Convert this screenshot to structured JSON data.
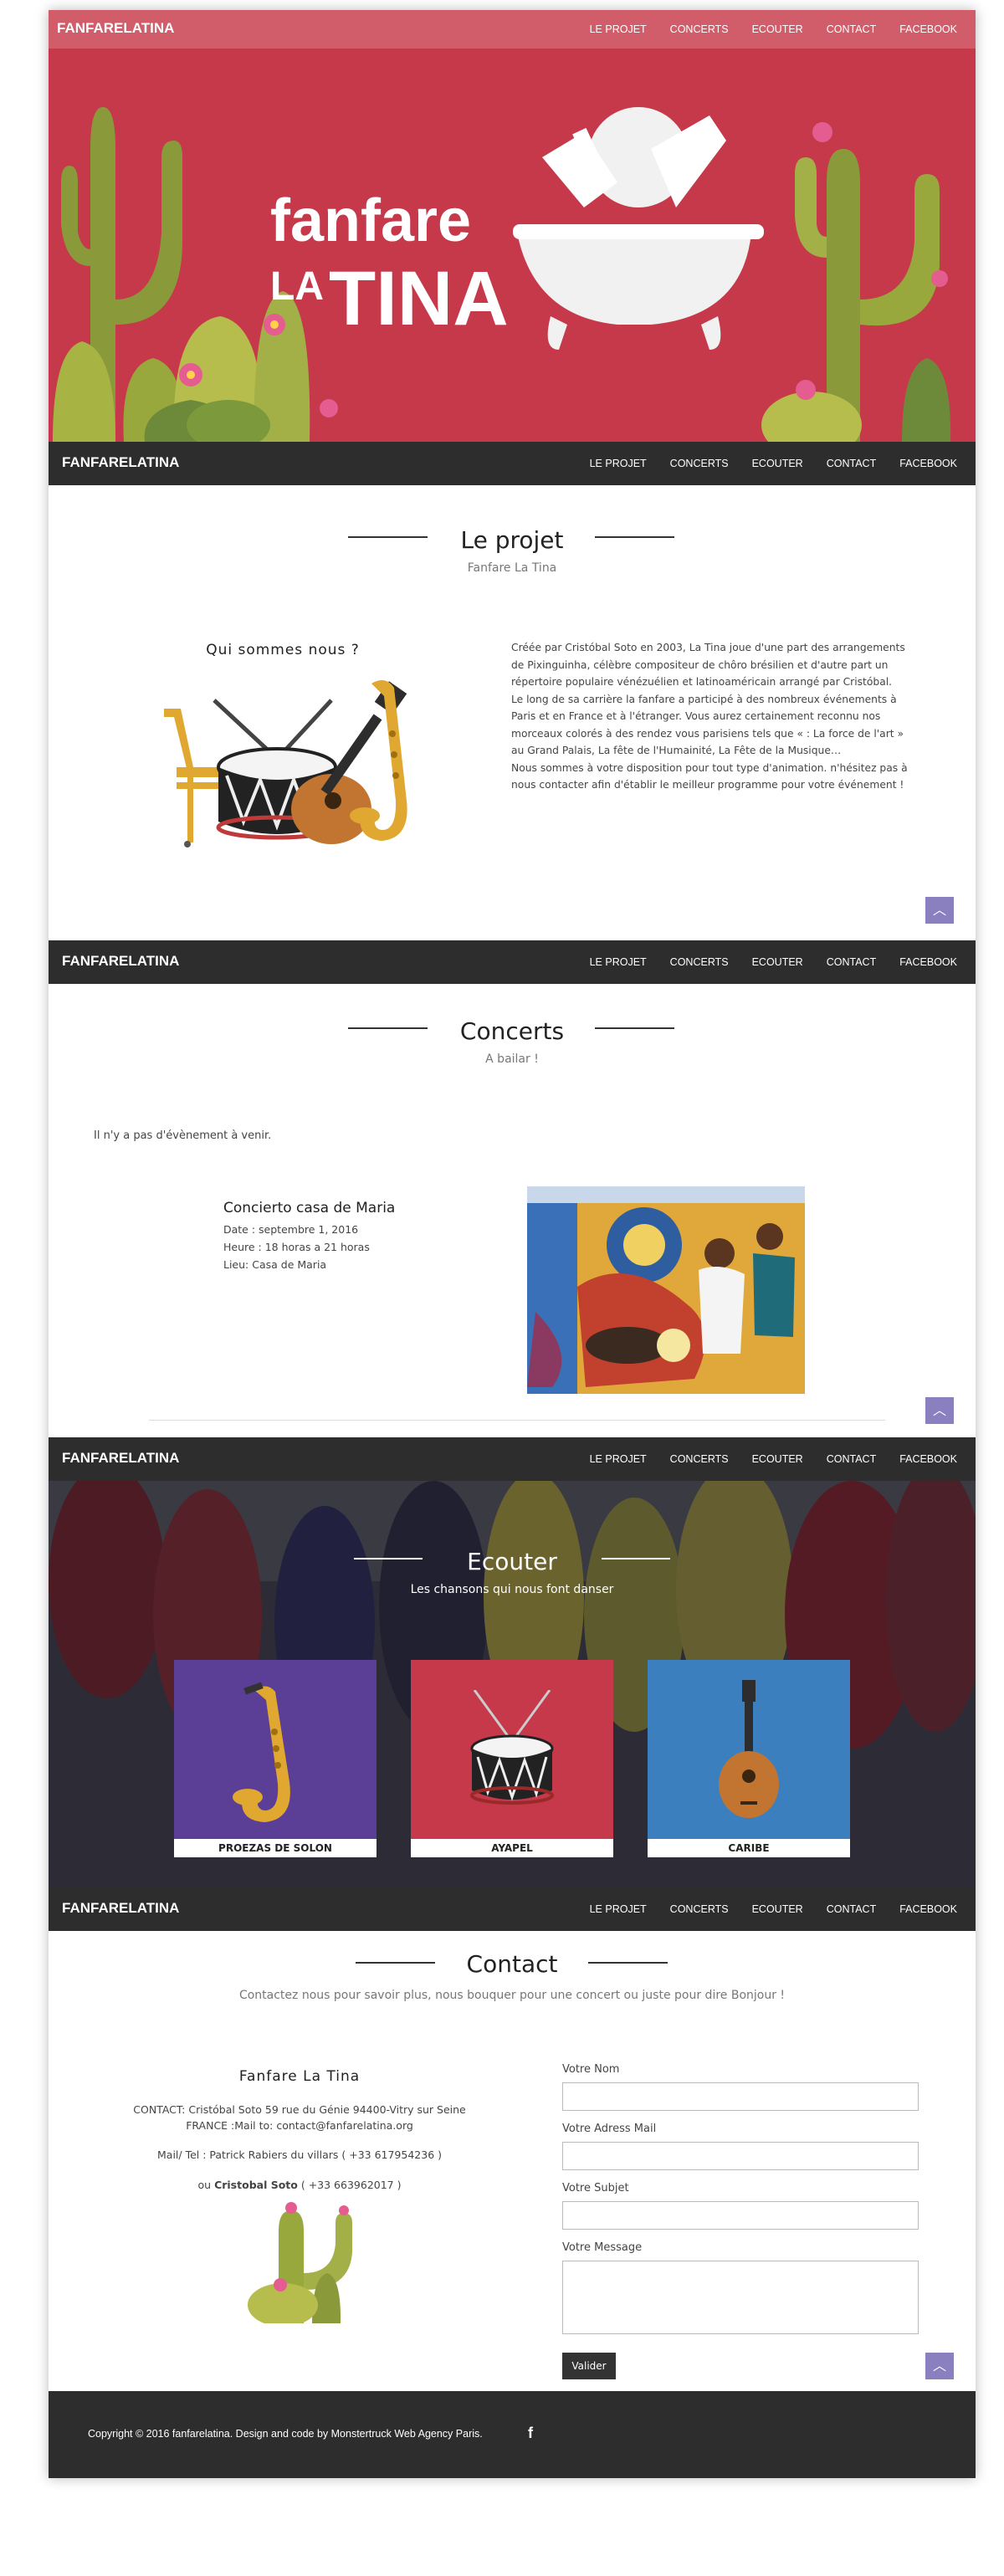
{
  "site": {
    "brand": "FANFARELATINA"
  },
  "nav": [
    "LE PROJET",
    "CONCERTS",
    "ECOUTER",
    "CONTACT",
    "FACEBOOK"
  ],
  "hero": {
    "logo_word1": "fanfare",
    "logo_word2a": "LA",
    "logo_word2b": "TINA"
  },
  "projet": {
    "title": "Le projet",
    "subtitle": "Fanfare La Tina",
    "heading": "Qui sommes nous ?",
    "paragraph1": "Créée par Cristóbal Soto en 2003, La Tina joue d'une part des arrangements de Pixinguinha, célèbre compositeur de chôro brésilien et d'autre part un répertoire populaire vénézuélien et latinoaméricain arrangé par Cristóbal.",
    "paragraph2": "Le long de sa carrière la fanfare a participé à des nombreux événements à Paris et en France et à l'étranger. Vous aurez certainement reconnu nos morceaux colorés à des rendez vous parisiens tels que « : La force de l'art » au Grand Palais, La fête de l'Humainité, La Fête de la Musique…",
    "paragraph3": "Nous sommes à votre disposition pour tout type d'animation. n'hésitez pas à nous contacter afin d'établir le meilleur programme pour votre événement !"
  },
  "concerts": {
    "title": "Concerts",
    "subtitle": "A bailar !",
    "no_event": "Il n'y a pas d'évènement à venir.",
    "event": {
      "name": "Concierto casa de Maria",
      "date": "Date : septembre 1, 2016",
      "time": "Heure : 18 horas a 21 horas",
      "place": "Lieu: Casa de Maria"
    }
  },
  "ecouter": {
    "title": "Ecouter",
    "subtitle": "Les chansons qui nous font danser",
    "tracks": [
      {
        "label": "PROEZAS DE SOLON",
        "color": "#5b3e96",
        "icon": "saxophone-icon"
      },
      {
        "label": "AYAPEL",
        "color": "#c5394b",
        "icon": "drum-icon"
      },
      {
        "label": "CARIBE",
        "color": "#3b7fbf",
        "icon": "mandolin-icon"
      }
    ]
  },
  "contact": {
    "title": "Contact",
    "subtitle": "Contactez nous pour savoir plus, nous bouquer pour une concert ou juste pour dire Bonjour !",
    "org_name": "Fanfare La Tina",
    "address1": "CONTACT: Cristóbal Soto 59 rue du Génie 94400-Vitry sur Seine",
    "address2": "FRANCE :Mail to: contact@fanfarelatina.org",
    "phone1": "Mail/ Tel : Patrick Rabiers du villars ( +33 617954236 )",
    "phone2_prefix": "ou",
    "phone2_name": "Cristobal Soto",
    "phone2_number": "( +33 663962017 )",
    "form": {
      "name_label": "Votre Nom",
      "email_label": "Votre Adress Mail",
      "subject_label": "Votre Subjet",
      "message_label": "Votre Message",
      "submit_label": "Valider"
    }
  },
  "footer": {
    "copyright": "Copyright © 2016 fanfarelatina. Design and code by Monstertruck Web Agency Paris.",
    "facebook_icon": "f"
  },
  "colors": {
    "hero": "#c5394b",
    "navbar": "#2d2d2d",
    "accent": "#8a80c0"
  }
}
